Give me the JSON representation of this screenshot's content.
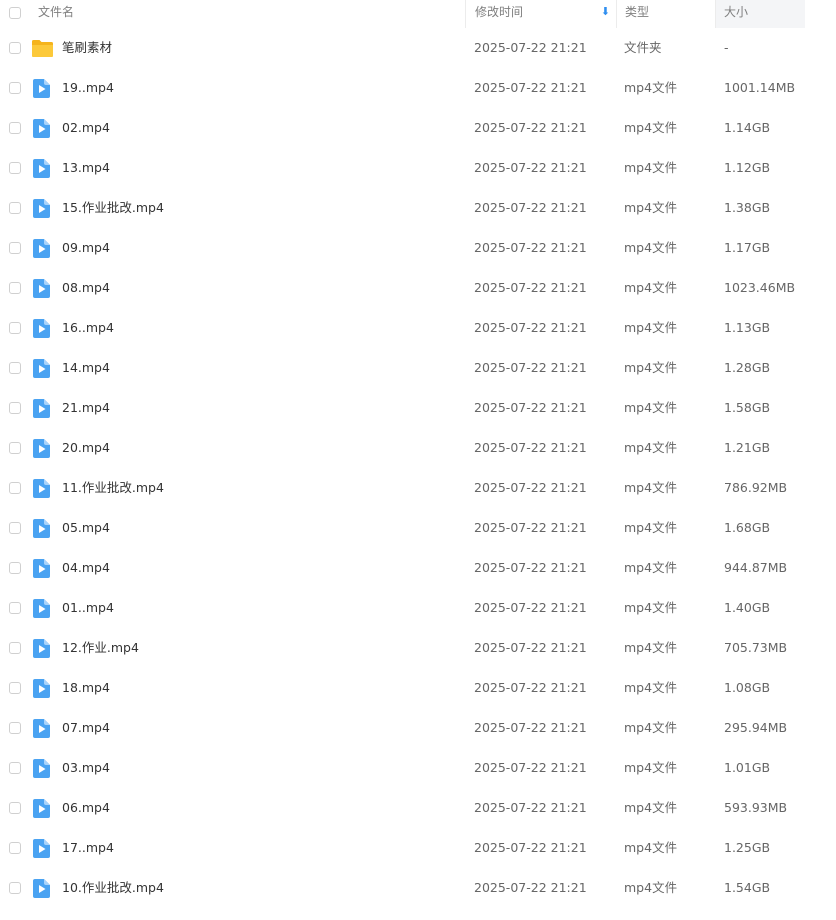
{
  "header": {
    "name_label": "文件名",
    "date_label": "修改时间",
    "type_label": "类型",
    "size_label": "大小",
    "sort_arrow": "⬇"
  },
  "accent_color": "#2f8ef0",
  "rows": [
    {
      "name": "笔刷素材",
      "date": "2025-07-22 21:21",
      "type": "文件夹",
      "size": "-",
      "icon": "folder-icon"
    },
    {
      "name": "19..mp4",
      "date": "2025-07-22 21:21",
      "type": "mp4文件",
      "size": "1001.14MB",
      "icon": "video-file-icon"
    },
    {
      "name": "02.mp4",
      "date": "2025-07-22 21:21",
      "type": "mp4文件",
      "size": "1.14GB",
      "icon": "video-file-icon"
    },
    {
      "name": "13.mp4",
      "date": "2025-07-22 21:21",
      "type": "mp4文件",
      "size": "1.12GB",
      "icon": "video-file-icon"
    },
    {
      "name": "15.作业批改.mp4",
      "date": "2025-07-22 21:21",
      "type": "mp4文件",
      "size": "1.38GB",
      "icon": "video-file-icon"
    },
    {
      "name": "09.mp4",
      "date": "2025-07-22 21:21",
      "type": "mp4文件",
      "size": "1.17GB",
      "icon": "video-file-icon"
    },
    {
      "name": "08.mp4",
      "date": "2025-07-22 21:21",
      "type": "mp4文件",
      "size": "1023.46MB",
      "icon": "video-file-icon"
    },
    {
      "name": "16..mp4",
      "date": "2025-07-22 21:21",
      "type": "mp4文件",
      "size": "1.13GB",
      "icon": "video-file-icon"
    },
    {
      "name": "14.mp4",
      "date": "2025-07-22 21:21",
      "type": "mp4文件",
      "size": "1.28GB",
      "icon": "video-file-icon"
    },
    {
      "name": "21.mp4",
      "date": "2025-07-22 21:21",
      "type": "mp4文件",
      "size": "1.58GB",
      "icon": "video-file-icon"
    },
    {
      "name": "20.mp4",
      "date": "2025-07-22 21:21",
      "type": "mp4文件",
      "size": "1.21GB",
      "icon": "video-file-icon"
    },
    {
      "name": "11.作业批改.mp4",
      "date": "2025-07-22 21:21",
      "type": "mp4文件",
      "size": "786.92MB",
      "icon": "video-file-icon"
    },
    {
      "name": "05.mp4",
      "date": "2025-07-22 21:21",
      "type": "mp4文件",
      "size": "1.68GB",
      "icon": "video-file-icon"
    },
    {
      "name": "04.mp4",
      "date": "2025-07-22 21:21",
      "type": "mp4文件",
      "size": "944.87MB",
      "icon": "video-file-icon"
    },
    {
      "name": "01..mp4",
      "date": "2025-07-22 21:21",
      "type": "mp4文件",
      "size": "1.40GB",
      "icon": "video-file-icon"
    },
    {
      "name": "12.作业.mp4",
      "date": "2025-07-22 21:21",
      "type": "mp4文件",
      "size": "705.73MB",
      "icon": "video-file-icon"
    },
    {
      "name": "18.mp4",
      "date": "2025-07-22 21:21",
      "type": "mp4文件",
      "size": "1.08GB",
      "icon": "video-file-icon"
    },
    {
      "name": "07.mp4",
      "date": "2025-07-22 21:21",
      "type": "mp4文件",
      "size": "295.94MB",
      "icon": "video-file-icon"
    },
    {
      "name": "03.mp4",
      "date": "2025-07-22 21:21",
      "type": "mp4文件",
      "size": "1.01GB",
      "icon": "video-file-icon"
    },
    {
      "name": "06.mp4",
      "date": "2025-07-22 21:21",
      "type": "mp4文件",
      "size": "593.93MB",
      "icon": "video-file-icon"
    },
    {
      "name": "17..mp4",
      "date": "2025-07-22 21:21",
      "type": "mp4文件",
      "size": "1.25GB",
      "icon": "video-file-icon"
    },
    {
      "name": "10.作业批改.mp4",
      "date": "2025-07-22 21:21",
      "type": "mp4文件",
      "size": "1.54GB",
      "icon": "video-file-icon"
    }
  ]
}
